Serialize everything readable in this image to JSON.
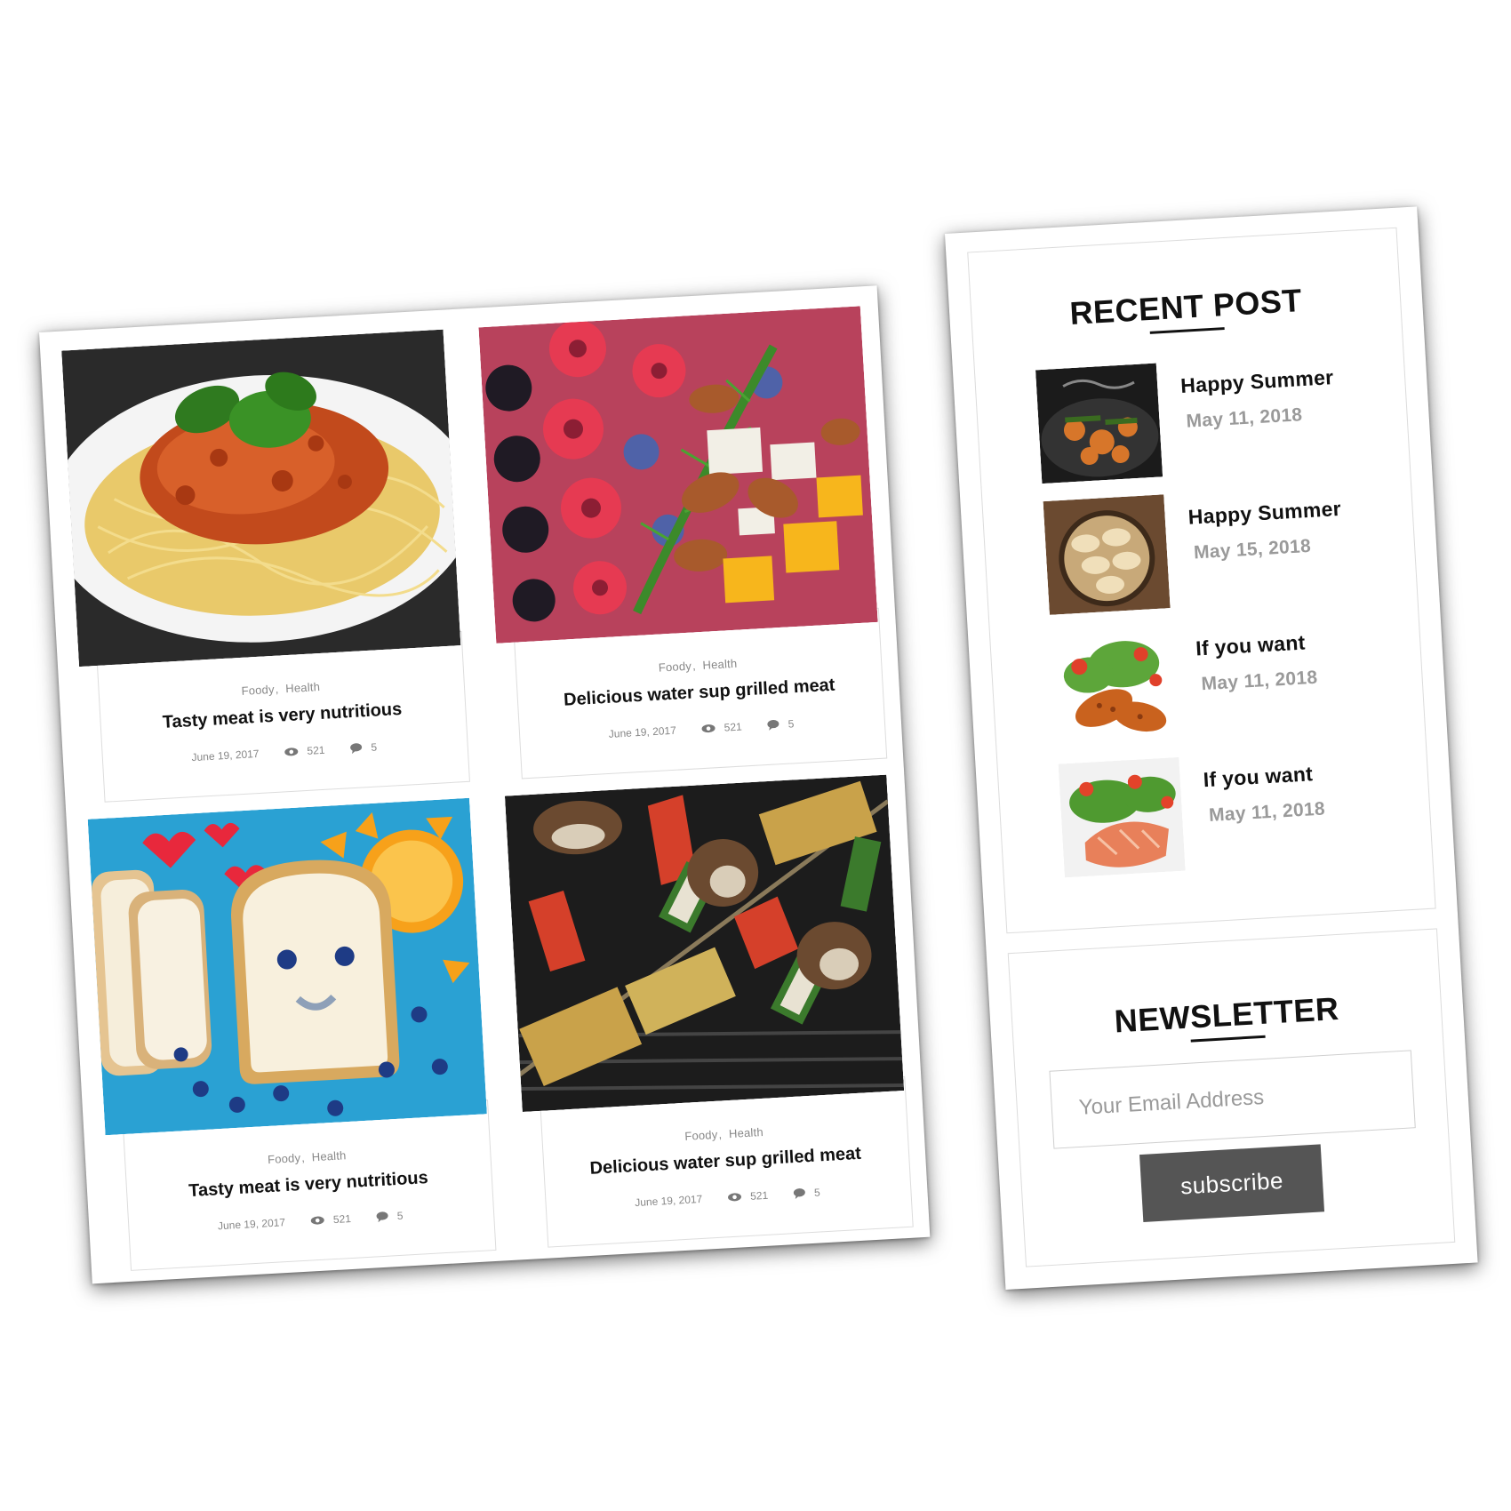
{
  "posts": [
    {
      "categories": [
        "Foody",
        "Health"
      ],
      "title": "Tasty meat is very nutritious",
      "date": "June 19, 2017",
      "views": "521",
      "comments": "5",
      "image": "spaghetti-bolognese"
    },
    {
      "categories": [
        "Foody",
        "Health"
      ],
      "title": "Delicious water sup grilled meat",
      "date": "June 19, 2017",
      "views": "521",
      "comments": "5",
      "image": "fruit-smoothie-bowl"
    },
    {
      "categories": [
        "Foody",
        "Health"
      ],
      "title": "Tasty meat is very nutritious",
      "date": "June 19, 2017",
      "views": "521",
      "comments": "5",
      "image": "bread-smiley-face"
    },
    {
      "categories": [
        "Foody",
        "Health"
      ],
      "title": "Delicious water sup grilled meat",
      "date": "June 19, 2017",
      "views": "521",
      "comments": "5",
      "image": "grilled-vegetable-skewers"
    }
  ],
  "recent_post": {
    "title": "RECENT POST",
    "items": [
      {
        "title": "Happy Summer",
        "date": "May 11, 2018",
        "image": "stir-fry-pan"
      },
      {
        "title": "Happy Summer",
        "date": "May 15, 2018",
        "image": "dumplings-plate"
      },
      {
        "title": "If you want",
        "date": "May 11, 2018",
        "image": "chicken-salad"
      },
      {
        "title": "If you want",
        "date": "May 11, 2018",
        "image": "salmon-salad"
      }
    ]
  },
  "newsletter": {
    "title": "NEWSLETTER",
    "email_placeholder": "Your Email Address",
    "subscribe_label": "subscribe"
  },
  "colors": {
    "button": "#555555",
    "text": "#111111",
    "muted": "#9a9a9a",
    "border": "#dddddd"
  }
}
